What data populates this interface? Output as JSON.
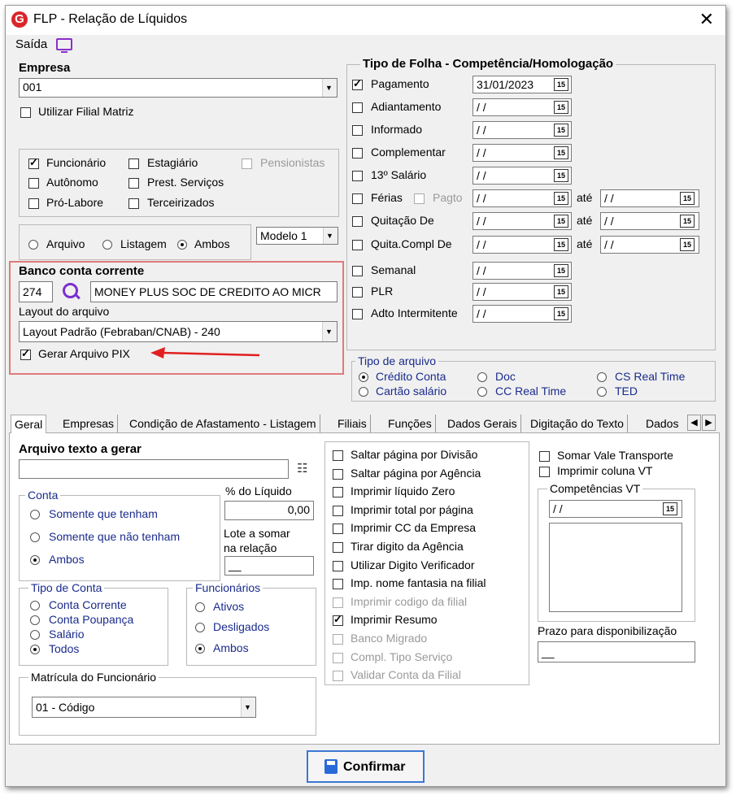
{
  "window": {
    "title": "FLP - Relação de Líquidos",
    "close_icon": "close-icon",
    "menu_saida": "Saída"
  },
  "empresa": {
    "label": "Empresa",
    "value": "001",
    "filial_label": "Utilizar Filial Matriz"
  },
  "categorias": {
    "funcionario": "Funcionário",
    "estagiario": "Estagiário",
    "pensionistas": "Pensionistas",
    "autonomo": "Autônomo",
    "prest_servicos": "Prest. Serviços",
    "pro_labore": "Pró-Labore",
    "terceirizados": "Terceirizados"
  },
  "saida_tipo": {
    "arquivo": "Arquivo",
    "listagem": "Listagem",
    "ambos": "Ambos",
    "modelo": "Modelo 1"
  },
  "banco": {
    "label": "Banco conta corrente",
    "codigo": "274",
    "nome": "MONEY PLUS SOC DE CREDITO AO MICR",
    "layout_label": "Layout do arquivo",
    "layout_value": "Layout Padrão (Febraban/CNAB) - 240",
    "pix_label": "Gerar Arquivo PIX",
    "annotation_color": "#e02020"
  },
  "tipo_folha": {
    "header": "Tipo de Folha  -  Competência/Homologação",
    "ate": "até",
    "pagto": "Pagto",
    "rows": [
      {
        "label": "Pagamento",
        "date": "31/01/2023",
        "checked": true
      },
      {
        "label": "Adiantamento",
        "date": " / /"
      },
      {
        "label": "Informado",
        "date": " / /"
      },
      {
        "label": "Complementar",
        "date": " / /"
      },
      {
        "label": "13º Salário",
        "date": " / /"
      },
      {
        "label": "Férias",
        "date": " / /",
        "date2": " / /"
      },
      {
        "label": "Quitação De",
        "date": " / /",
        "date2": " / /"
      },
      {
        "label": "Quita.Compl De",
        "date": " / /",
        "date2": " / /"
      },
      {
        "label": "Semanal",
        "date": " / /"
      },
      {
        "label": "PLR",
        "date": " / /"
      },
      {
        "label": "Adto Intermitente",
        "date": " / /"
      }
    ]
  },
  "tipo_arquivo": {
    "legend": "Tipo de arquivo",
    "credito_conta": "Crédito Conta",
    "doc": "Doc",
    "cs_real_time": "CS Real Time",
    "cartao_salario": "Cartão salário",
    "cc_real_time": "CC Real Time",
    "ted": "TED"
  },
  "tabs": [
    "Geral",
    "Empresas",
    "Condição de Afastamento - Listagem",
    "Filiais",
    "Funções",
    "Dados Gerais",
    "Digitação do Texto",
    "Dados"
  ],
  "geral": {
    "arquivo_texto_label": "Arquivo texto a gerar",
    "conta_legend": "Conta",
    "conta_opts": [
      "Somente que tenham",
      "Somente que não tenham",
      "Ambos"
    ],
    "pct_liquido_label": "% do Líquido",
    "pct_liquido_value": "0,00",
    "lote_label": "Lote a somar na relação",
    "lote_value": "__",
    "tipo_conta_legend": "Tipo de Conta",
    "tipo_conta_opts": [
      "Conta Corrente",
      "Conta Poupança",
      "Salário",
      "Todos"
    ],
    "funcionarios_legend": "Funcionários",
    "funcionarios_opts": [
      "Ativos",
      "Desligados",
      "Ambos"
    ],
    "matricula_legend": "Matrícula do Funcionário",
    "matricula_value": "01 - Código",
    "options": [
      {
        "label": "Saltar página por Divisão"
      },
      {
        "label": "Saltar página por Agência"
      },
      {
        "label": "Imprimir líquido Zero"
      },
      {
        "label": "Imprimir total por página"
      },
      {
        "label": "Imprimir CC da Empresa"
      },
      {
        "label": "Tirar digito da Agência"
      },
      {
        "label": "Utilizar Digito Verificador"
      },
      {
        "label": "Imp. nome fantasia na filial"
      },
      {
        "label": "Imprimir codigo da filial",
        "disabled": true
      },
      {
        "label": "Imprimir Resumo",
        "checked": true
      },
      {
        "label": "Banco Migrado",
        "disabled": true
      },
      {
        "label": "Compl. Tipo Serviço",
        "disabled": true
      },
      {
        "label": "Validar Conta da Filial",
        "disabled": true
      }
    ],
    "somar_vt": "Somar Vale Transporte",
    "imprimir_vt": "Imprimir coluna VT",
    "competencias_legend": "Competências VT",
    "competencias_date": " / /",
    "prazo_label": "Prazo para disponibilização",
    "prazo_value": "__"
  },
  "confirmar": "Confirmar"
}
